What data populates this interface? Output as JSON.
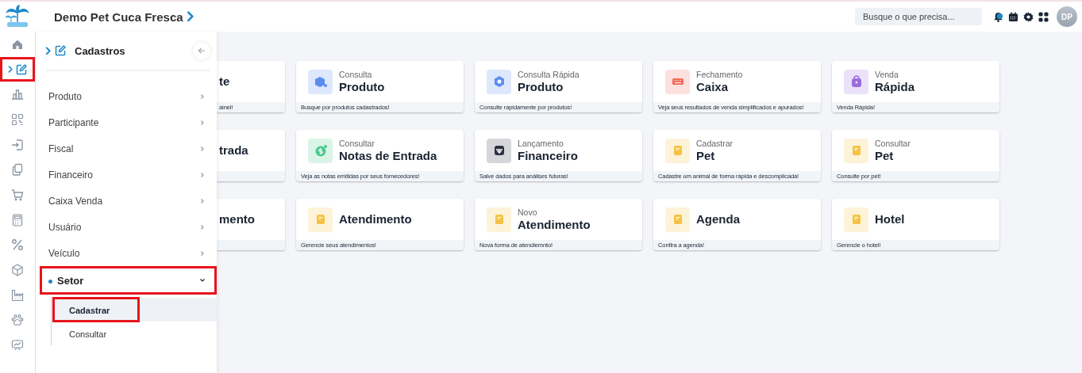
{
  "header": {
    "title": "Demo Pet Cuca Fresca",
    "search": {
      "placeholder": "Busque o que precisa..."
    },
    "avatar": "DP"
  },
  "rail": {
    "items": [
      {
        "selected": false,
        "highlighted": false
      },
      {
        "selected": true,
        "highlighted": true
      },
      {
        "selected": false,
        "highlighted": false
      },
      {
        "selected": false,
        "highlighted": false
      },
      {
        "selected": false,
        "highlighted": false
      },
      {
        "selected": false,
        "highlighted": false
      },
      {
        "selected": false,
        "highlighted": false
      },
      {
        "selected": false,
        "highlighted": false
      },
      {
        "selected": false,
        "highlighted": false
      },
      {
        "selected": false,
        "highlighted": false
      },
      {
        "selected": false,
        "highlighted": false
      },
      {
        "selected": false,
        "highlighted": false
      },
      {
        "selected": false,
        "highlighted": false
      }
    ]
  },
  "panel": {
    "title": "Cadastros",
    "items": [
      {
        "label": "Produto",
        "expanded": false,
        "highlighted": false
      },
      {
        "label": "Participante",
        "expanded": false,
        "highlighted": false
      },
      {
        "label": "Fiscal",
        "expanded": false,
        "highlighted": false
      },
      {
        "label": "Financeiro",
        "expanded": false,
        "highlighted": false
      },
      {
        "label": "Caixa Venda",
        "expanded": false,
        "highlighted": false
      },
      {
        "label": "Usuário",
        "expanded": false,
        "highlighted": false
      },
      {
        "label": "Veículo",
        "expanded": false,
        "highlighted": false
      },
      {
        "label": "Setor",
        "expanded": true,
        "highlighted": true,
        "children": [
          {
            "label": "Cadastrar",
            "selected": true,
            "highlighted": true
          },
          {
            "label": "Consultar",
            "selected": false,
            "highlighted": false
          }
        ]
      }
    ]
  },
  "cards": [
    {
      "kind": "cut",
      "title": "te",
      "description": "ainel!"
    },
    {
      "kind": "tile",
      "subtitle": "Consulta",
      "title": "Produto",
      "description": "Busque por produtos cadastrados!",
      "color": "#5b8def"
    },
    {
      "kind": "tile",
      "subtitle": "Consulta Rápida",
      "title": "Produto",
      "description": "Consulte rapidamente por produtos!",
      "color": "#5b8def"
    },
    {
      "kind": "tile",
      "subtitle": "Fechamento",
      "title": "Caixa",
      "description": "Veja seus resultados de venda simplificados e apurados!",
      "color": "#f26b5b"
    },
    {
      "kind": "tile",
      "subtitle": "Venda",
      "title": "Rápida",
      "description": "Venda Rápida!",
      "color": "#9b6bdf"
    },
    {
      "kind": "cut",
      "title": "trada"
    },
    {
      "kind": "tile",
      "subtitle": "Consultar",
      "title": "Notas de Entrada",
      "description": "Veja as notas emitidas por seus fornecedores!",
      "color": "#4cc98a"
    },
    {
      "kind": "tile",
      "subtitle": "Lançamento",
      "title": "Financeiro",
      "description": "Salve dados para análises futuras!",
      "color": "#2b3140"
    },
    {
      "kind": "tile",
      "subtitle": "Cadastrar",
      "title": "Pet",
      "description": "Cadastre um animal de forma rápida e descomplicada!",
      "color": "#f5c242"
    },
    {
      "kind": "tile",
      "subtitle": "Consultar",
      "title": "Pet",
      "description": "Consulte por pet!",
      "color": "#f5c242"
    },
    {
      "kind": "cut",
      "title": "mento"
    },
    {
      "kind": "tile",
      "title": "Atendimento",
      "description": "Gerencie seus atendimentos!",
      "color": "#f5c242"
    },
    {
      "kind": "tile",
      "subtitle": "Novo",
      "title": "Atendimento",
      "description": "Nova forma de atendiemnto!",
      "color": "#f5c242"
    },
    {
      "kind": "tile",
      "title": "Agenda",
      "description": "Confira a agenda!",
      "color": "#f5c242"
    },
    {
      "kind": "tile",
      "title": "Hotel",
      "description": "Gerencie o hotel!",
      "color": "#f5c242"
    }
  ]
}
